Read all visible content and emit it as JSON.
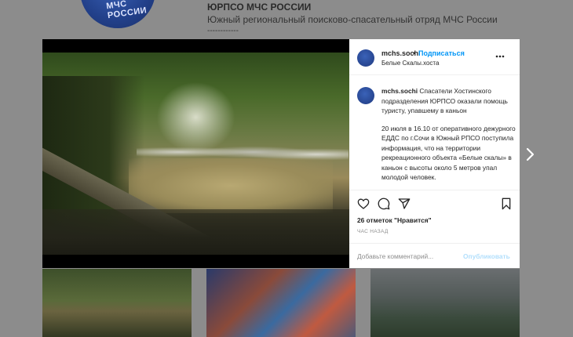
{
  "profile": {
    "name": "ЮРПСО МЧС РОССИИ",
    "bio": "Южный региональный поисково-спасательный отряд МЧС России",
    "bio_dashes": "------------",
    "avatar_text": "МЧС РОССИИ"
  },
  "post": {
    "username": "mchs.sochi",
    "dot": "•",
    "follow_label": "Подписаться",
    "location": "Белые Скалы.хоста",
    "caption_title": "Спасатели Хостинского подразделения ЮРПСО оказали помощь туристу, упавшему в каньон",
    "caption_body": "20 июля в 16.10 от оперативного дежурного ЕДДС по г.Сочи в Южный РПСО поступила информация, что на территории рекреационного объекта «Белые скалы» в каньон с высоты около 5 метров упал молодой человек.",
    "likes": "26 отметок \"Нравится\"",
    "time": "ЧАС НАЗАД",
    "comment_placeholder": "Добавьте комментарий...",
    "publish_label": "Опубликовать"
  },
  "icons": {
    "like": "heart-icon",
    "comment": "comment-icon",
    "share": "share-icon",
    "save": "bookmark-icon",
    "more": "more-options-icon",
    "next": "chevron-right-icon"
  },
  "colors": {
    "link_blue": "#0095f6",
    "publish_disabled": "#b2dffc",
    "text": "#262626",
    "muted": "#8e8e8e"
  }
}
